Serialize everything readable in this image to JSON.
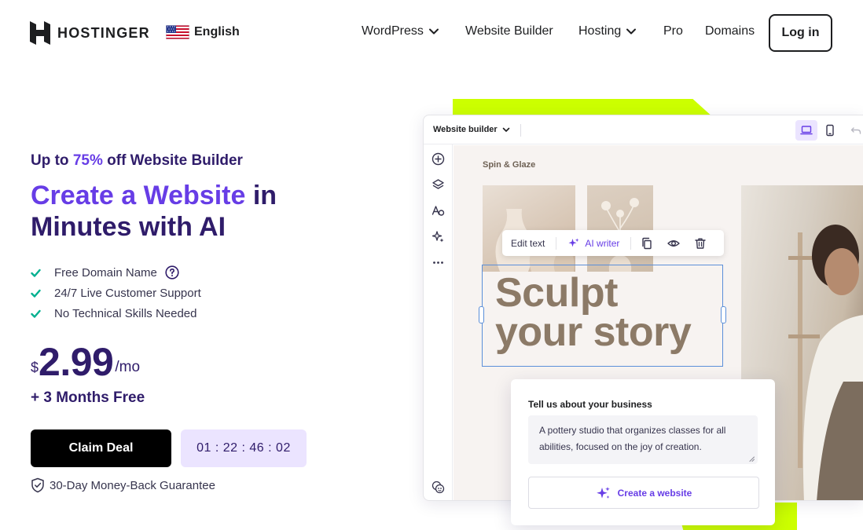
{
  "header": {
    "brand": "HOSTINGER",
    "language": "English",
    "nav": [
      {
        "label": "WordPress",
        "has_dropdown": true
      },
      {
        "label": "Website Builder",
        "has_dropdown": false
      },
      {
        "label": "Hosting",
        "has_dropdown": true
      },
      {
        "label": "Pro",
        "has_dropdown": false
      },
      {
        "label": "Domains",
        "has_dropdown": false
      }
    ],
    "login_label": "Log in"
  },
  "hero": {
    "promo_prefix": "Up to ",
    "promo_discount": "75%",
    "promo_suffix": " off Website Builder",
    "headline_accent": "Create a Website",
    "headline_rest_1": " in",
    "headline_rest_2": "Minutes with AI",
    "features": [
      "Free Domain Name",
      "24/7 Live Customer Support",
      "No Technical Skills Needed"
    ],
    "price_currency": "$",
    "price_amount": "2.99",
    "price_period": "/mo",
    "bonus": "+ 3 Months Free",
    "cta_label": "Claim Deal",
    "countdown": "01 : 22 : 46 : 02",
    "guarantee": "30-Day Money-Back Guarantee"
  },
  "builder": {
    "mode_label": "Website builder",
    "site_name": "Spin & Glaze",
    "toolbar": {
      "edit_text": "Edit text",
      "ai_writer": "AI writer"
    },
    "headline_line1": "Sculpt",
    "headline_line2": "your story",
    "business_prompt_title": "Tell us about your business",
    "business_description": "A pottery studio that organizes classes for all abilities, focused on the joy of creation.",
    "create_button": "Create a website"
  },
  "colors": {
    "brand_purple": "#673de6",
    "dark_navy": "#2f1c6a",
    "lime_accent": "#ccff00",
    "feature_check": "#00b090",
    "timer_bg": "#ebe4ff"
  },
  "icons": [
    "hostinger-logo",
    "us-flag-icon",
    "chevron-down-icon",
    "help-circle-icon",
    "check-icon",
    "shield-icon",
    "desktop-icon",
    "mobile-icon",
    "undo-icon",
    "add-icon",
    "layers-icon",
    "typography-icon",
    "sparkles-icon",
    "more-icon",
    "palette-icon",
    "copy-icon",
    "eye-icon",
    "trash-icon"
  ]
}
